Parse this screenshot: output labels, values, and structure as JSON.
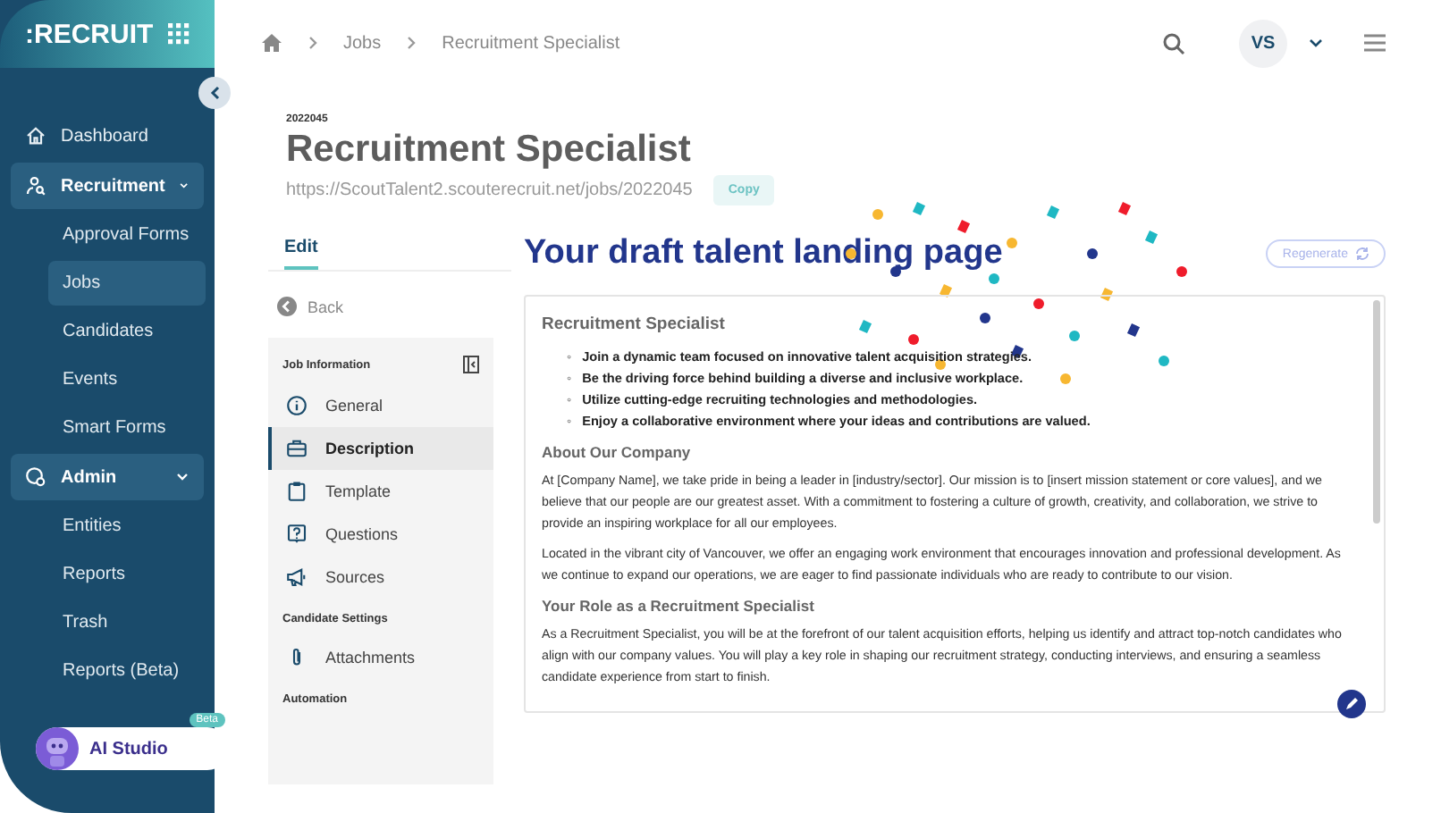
{
  "sidebar": {
    "logo": ":RECRUIT",
    "items": [
      {
        "label": "Dashboard",
        "kind": "link"
      },
      {
        "label": "Recruitment",
        "kind": "group",
        "expanded": true,
        "children": [
          {
            "label": "Approval Forms",
            "selected": false
          },
          {
            "label": "Jobs",
            "selected": true
          },
          {
            "label": "Candidates",
            "selected": false
          },
          {
            "label": "Events",
            "selected": false
          },
          {
            "label": "Smart Forms",
            "selected": false
          }
        ]
      },
      {
        "label": "Admin",
        "kind": "group",
        "expanded": true,
        "children": [
          {
            "label": "Entities",
            "selected": false
          },
          {
            "label": "Reports",
            "selected": false
          },
          {
            "label": "Trash",
            "selected": false
          },
          {
            "label": "Reports (Beta)",
            "selected": false
          }
        ]
      }
    ],
    "ai_studio": {
      "label": "AI Studio",
      "badge": "Beta"
    }
  },
  "breadcrumb": [
    "Jobs",
    "Recruitment Specialist"
  ],
  "user": {
    "initials": "VS"
  },
  "job": {
    "id": "2022045",
    "title": "Recruitment Specialist",
    "url": "https://ScoutTalent2.scouterecruit.net/jobs/2022045",
    "copy": "Copy"
  },
  "editor": {
    "tab": "Edit",
    "back": "Back",
    "sections": [
      {
        "title": "Job Information",
        "items": [
          {
            "label": "General",
            "selected": false
          },
          {
            "label": "Description",
            "selected": true
          },
          {
            "label": "Template",
            "selected": false
          },
          {
            "label": "Questions",
            "selected": false
          },
          {
            "label": "Sources",
            "selected": false
          }
        ]
      },
      {
        "title": "Candidate Settings",
        "items": [
          {
            "label": "Attachments",
            "selected": false
          }
        ]
      },
      {
        "title": "Automation"
      }
    ]
  },
  "preview": {
    "heading": "Your draft talent landing page",
    "regenerate": "Regenerate",
    "doc": {
      "title": "Recruitment Specialist",
      "marker": "◦",
      "bullets": [
        "Join a dynamic team focused on innovative talent acquisition strategies.",
        "Be the driving force behind building a diverse and inclusive workplace.",
        "Utilize cutting-edge recruiting technologies and methodologies.",
        "Enjoy a collaborative environment where your ideas and contributions are valued."
      ],
      "sections": [
        {
          "heading": "About Our Company",
          "paragraphs": [
            "At [Company Name], we take pride in being a leader in [industry/sector]. Our mission is to [insert mission statement or core values], and we believe that our people are our greatest asset. With a commitment to fostering a culture of growth, creativity, and collaboration, we strive to provide an inspiring workplace for all our employees.",
            "Located in the vibrant city of Vancouver, we offer an engaging work environment that encourages innovation and professional development. As we continue to expand our operations, we are eager to find passionate individuals who are ready to contribute to our vision."
          ]
        },
        {
          "heading": "Your Role as a Recruitment Specialist",
          "paragraphs": [
            "As a Recruitment Specialist, you will be at the forefront of our talent acquisition efforts, helping us identify and attract top-notch candidates who align with our company values. You will play a key role in shaping our recruitment strategy, conducting interviews, and ensuring a seamless candidate experience from start to finish."
          ]
        }
      ]
    }
  }
}
